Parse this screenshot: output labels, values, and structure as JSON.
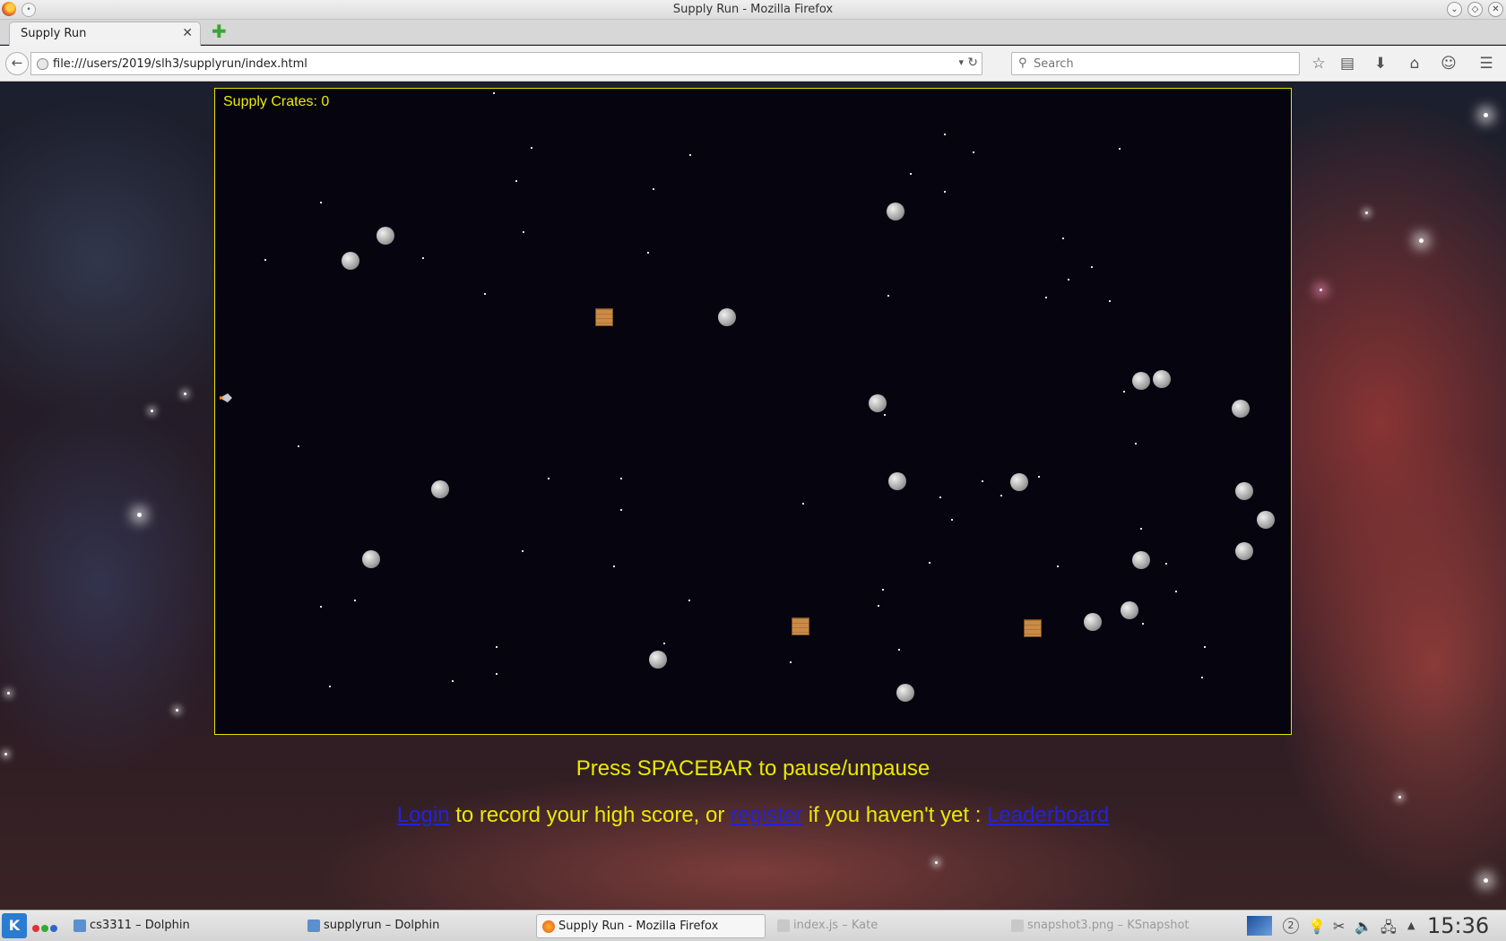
{
  "window": {
    "title": "Supply Run - Mozilla Firefox"
  },
  "browser": {
    "tab_label": "Supply Run",
    "url": "file:///users/2019/slh3/supplyrun/index.html",
    "search_placeholder": "Search"
  },
  "game": {
    "score_text": "Supply Crates: 0",
    "instructions": "Press SPACEBAR to pause/unpause",
    "login_link": "Login",
    "text_middle": " to record your high score, or ",
    "register_link": "register",
    "text_after": " if you haven't yet : ",
    "leaderboard_link": "Leaderboard",
    "colors": {
      "text": "#eaea00",
      "border": "#e6e000",
      "link": "#2222dd",
      "background": "#05040f"
    }
  },
  "taskbar": {
    "tasks": [
      {
        "label": "cs3311 – Dolphin",
        "state": "normal"
      },
      {
        "label": "supplyrun – Dolphin",
        "state": "normal"
      },
      {
        "label": "Supply Run - Mozilla Firefox",
        "state": "active"
      },
      {
        "label": "index.js – Kate",
        "state": "minimized"
      },
      {
        "label": "snapshot3.png – KSnapshot",
        "state": "minimized"
      }
    ],
    "tray_badge": "2",
    "clock": "15:36"
  }
}
